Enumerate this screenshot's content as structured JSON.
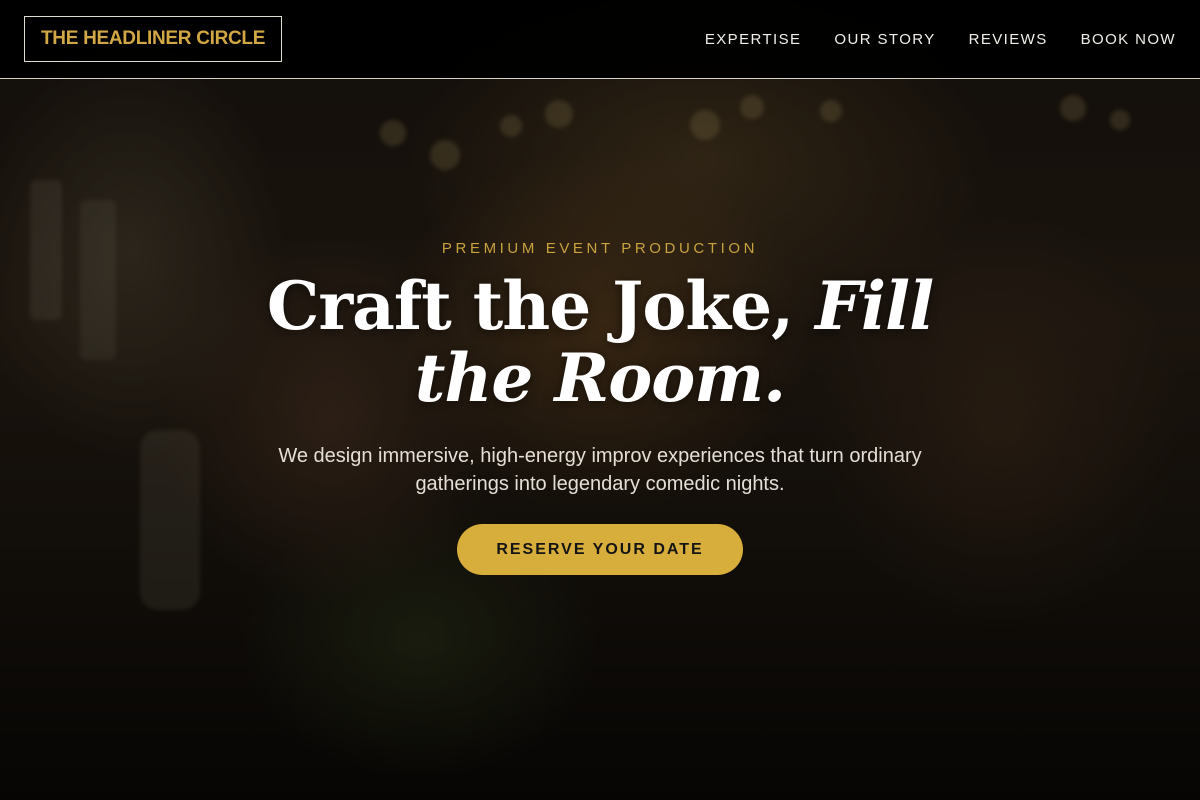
{
  "brand": {
    "logo_text": "THE HEADLINER CIRCLE",
    "accent_color": "#d7ad3c"
  },
  "nav": {
    "items": [
      {
        "label": "EXPERTISE"
      },
      {
        "label": "OUR STORY"
      },
      {
        "label": "REVIEWS"
      },
      {
        "label": "BOOK NOW"
      }
    ]
  },
  "hero": {
    "eyebrow": "PREMIUM EVENT PRODUCTION",
    "headline_plain": "Craft the Joke, ",
    "headline_italic": "Fill the Room.",
    "subtext": "We design immersive, high-energy improv experiences that turn ordinary gatherings into legendary comedic nights.",
    "cta_label": "RESERVE YOUR DATE",
    "background_image": "blurred-party-toast-photo"
  }
}
